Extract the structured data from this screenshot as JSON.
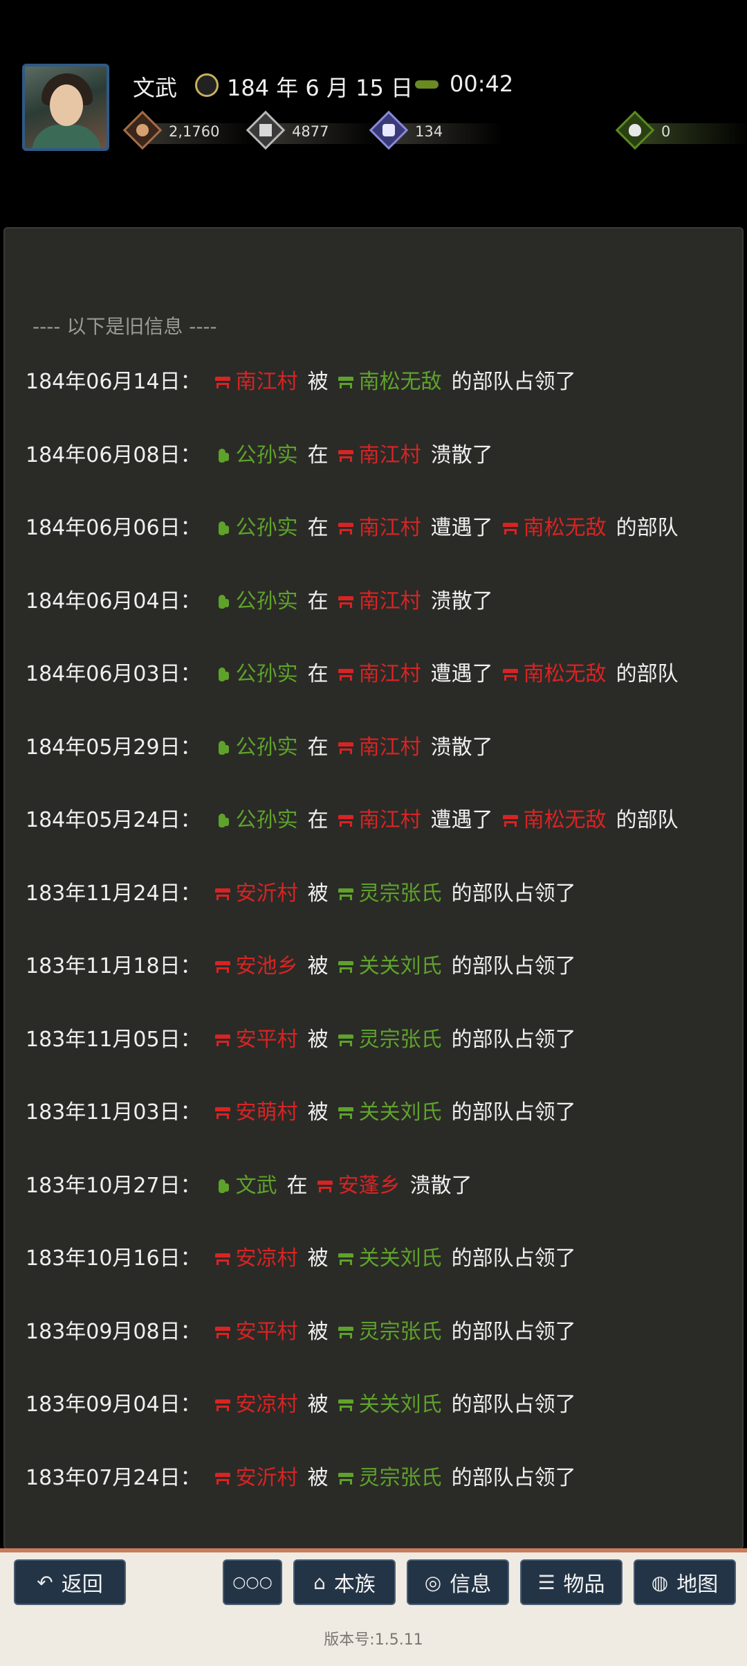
{
  "header": {
    "name": "文武",
    "date": "184 年 6 月 15 日",
    "time": "00:42",
    "stats": [
      {
        "icon": "money-icon",
        "value": "2,1760"
      },
      {
        "icon": "food-icon",
        "value": "4877"
      },
      {
        "icon": "soldier-icon",
        "value": "134"
      },
      {
        "icon": "bag-icon",
        "value": "0"
      }
    ]
  },
  "panel": {
    "old_header": "---- 以下是旧信息 ----",
    "rows": [
      {
        "date": "184年06月14日：",
        "parts": [
          {
            "t": "village",
            "txt": "南江村",
            "c": "red"
          },
          {
            "t": "text",
            "txt": "被"
          },
          {
            "t": "army",
            "txt": "南松无敌",
            "c": "green"
          },
          {
            "t": "text",
            "txt": "的部队占领了"
          }
        ]
      },
      {
        "date": "184年06月08日：",
        "parts": [
          {
            "t": "hand",
            "txt": "公孙实",
            "c": "green"
          },
          {
            "t": "text",
            "txt": "在"
          },
          {
            "t": "village",
            "txt": "南江村",
            "c": "red"
          },
          {
            "t": "text",
            "txt": "溃散了"
          }
        ]
      },
      {
        "date": "184年06月06日：",
        "parts": [
          {
            "t": "hand",
            "txt": "公孙实",
            "c": "green"
          },
          {
            "t": "text",
            "txt": "在"
          },
          {
            "t": "village",
            "txt": "南江村",
            "c": "red"
          },
          {
            "t": "text",
            "txt": "遭遇了"
          },
          {
            "t": "army",
            "txt": "南松无敌",
            "c": "red"
          },
          {
            "t": "text",
            "txt": "的部队"
          }
        ]
      },
      {
        "date": "184年06月04日：",
        "parts": [
          {
            "t": "hand",
            "txt": "公孙实",
            "c": "green"
          },
          {
            "t": "text",
            "txt": "在"
          },
          {
            "t": "village",
            "txt": "南江村",
            "c": "red"
          },
          {
            "t": "text",
            "txt": "溃散了"
          }
        ]
      },
      {
        "date": "184年06月03日：",
        "parts": [
          {
            "t": "hand",
            "txt": "公孙实",
            "c": "green"
          },
          {
            "t": "text",
            "txt": "在"
          },
          {
            "t": "village",
            "txt": "南江村",
            "c": "red"
          },
          {
            "t": "text",
            "txt": "遭遇了"
          },
          {
            "t": "army",
            "txt": "南松无敌",
            "c": "red"
          },
          {
            "t": "text",
            "txt": "的部队"
          }
        ]
      },
      {
        "date": "184年05月29日：",
        "parts": [
          {
            "t": "hand",
            "txt": "公孙实",
            "c": "green"
          },
          {
            "t": "text",
            "txt": "在"
          },
          {
            "t": "village",
            "txt": "南江村",
            "c": "red"
          },
          {
            "t": "text",
            "txt": "溃散了"
          }
        ]
      },
      {
        "date": "184年05月24日：",
        "parts": [
          {
            "t": "hand",
            "txt": "公孙实",
            "c": "green"
          },
          {
            "t": "text",
            "txt": "在"
          },
          {
            "t": "village",
            "txt": "南江村",
            "c": "red"
          },
          {
            "t": "text",
            "txt": "遭遇了"
          },
          {
            "t": "army",
            "txt": "南松无敌",
            "c": "red"
          },
          {
            "t": "text",
            "txt": "的部队"
          }
        ]
      },
      {
        "date": "183年11月24日：",
        "parts": [
          {
            "t": "village",
            "txt": "安沂村",
            "c": "red"
          },
          {
            "t": "text",
            "txt": "被"
          },
          {
            "t": "army",
            "txt": "灵宗张氏",
            "c": "green"
          },
          {
            "t": "text",
            "txt": "的部队占领了"
          }
        ]
      },
      {
        "date": "183年11月18日：",
        "parts": [
          {
            "t": "village",
            "txt": "安池乡",
            "c": "red"
          },
          {
            "t": "text",
            "txt": "被"
          },
          {
            "t": "army",
            "txt": "关关刘氏",
            "c": "green"
          },
          {
            "t": "text",
            "txt": "的部队占领了"
          }
        ]
      },
      {
        "date": "183年11月05日：",
        "parts": [
          {
            "t": "village",
            "txt": "安平村",
            "c": "red"
          },
          {
            "t": "text",
            "txt": "被"
          },
          {
            "t": "army",
            "txt": "灵宗张氏",
            "c": "green"
          },
          {
            "t": "text",
            "txt": "的部队占领了"
          }
        ]
      },
      {
        "date": "183年11月03日：",
        "parts": [
          {
            "t": "village",
            "txt": "安萌村",
            "c": "red"
          },
          {
            "t": "text",
            "txt": "被"
          },
          {
            "t": "army",
            "txt": "关关刘氏",
            "c": "green"
          },
          {
            "t": "text",
            "txt": "的部队占领了"
          }
        ]
      },
      {
        "date": "183年10月27日：",
        "parts": [
          {
            "t": "hand",
            "txt": "文武",
            "c": "green"
          },
          {
            "t": "text",
            "txt": "在"
          },
          {
            "t": "village",
            "txt": "安蓬乡",
            "c": "red"
          },
          {
            "t": "text",
            "txt": "溃散了"
          }
        ]
      },
      {
        "date": "183年10月16日：",
        "parts": [
          {
            "t": "village",
            "txt": "安凉村",
            "c": "red"
          },
          {
            "t": "text",
            "txt": "被"
          },
          {
            "t": "army",
            "txt": "关关刘氏",
            "c": "green"
          },
          {
            "t": "text",
            "txt": "的部队占领了"
          }
        ]
      },
      {
        "date": "183年09月08日：",
        "parts": [
          {
            "t": "village",
            "txt": "安平村",
            "c": "red"
          },
          {
            "t": "text",
            "txt": "被"
          },
          {
            "t": "army",
            "txt": "灵宗张氏",
            "c": "green"
          },
          {
            "t": "text",
            "txt": "的部队占领了"
          }
        ]
      },
      {
        "date": "183年09月04日：",
        "parts": [
          {
            "t": "village",
            "txt": "安凉村",
            "c": "red"
          },
          {
            "t": "text",
            "txt": "被"
          },
          {
            "t": "army",
            "txt": "关关刘氏",
            "c": "green"
          },
          {
            "t": "text",
            "txt": "的部队占领了"
          }
        ]
      },
      {
        "date": "183年07月24日：",
        "parts": [
          {
            "t": "village",
            "txt": "安沂村",
            "c": "red"
          },
          {
            "t": "text",
            "txt": "被"
          },
          {
            "t": "army",
            "txt": "灵宗张氏",
            "c": "green"
          },
          {
            "t": "text",
            "txt": "的部队占领了"
          }
        ]
      }
    ]
  },
  "bottom": {
    "back": "返回",
    "more": "○○○",
    "clan": "本族",
    "info": "信息",
    "items": "物品",
    "map": "地图",
    "version": "版本号:1.5.11"
  },
  "colors": {
    "accent_red": "#d92323",
    "accent_green": "#5fa22b",
    "button_bg": "#233446"
  }
}
